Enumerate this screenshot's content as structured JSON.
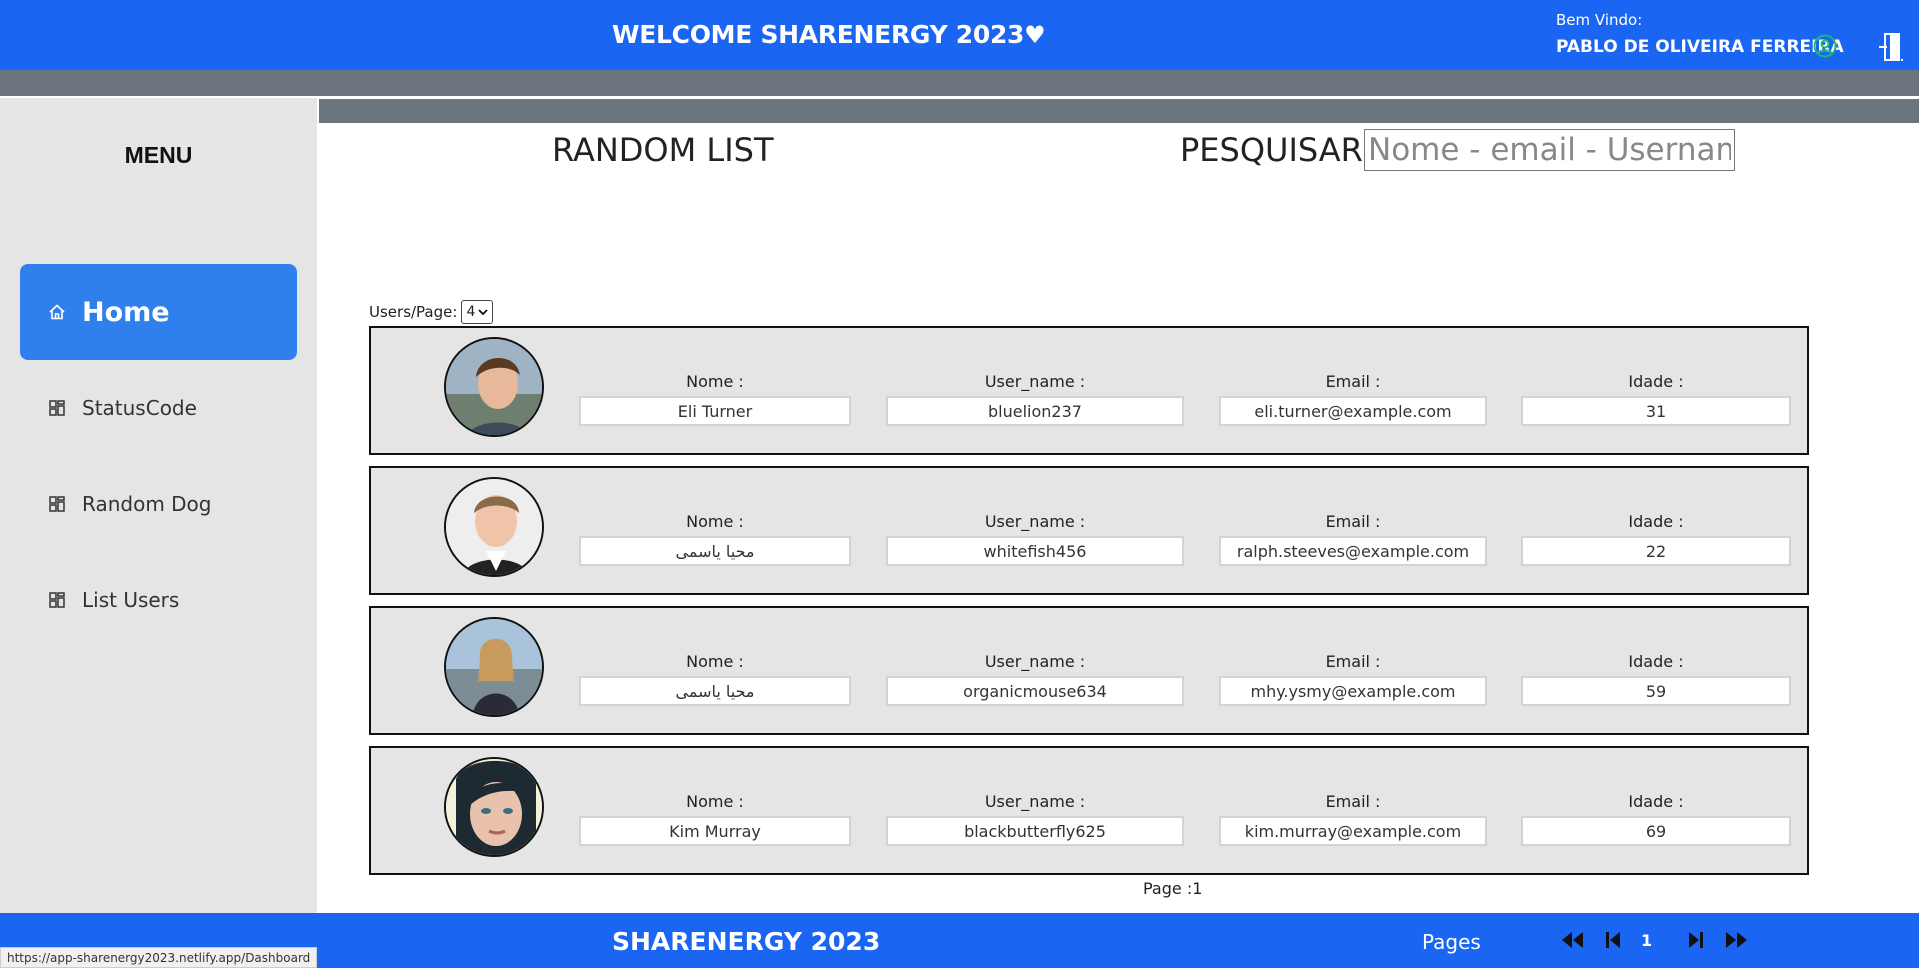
{
  "header": {
    "title": "WELCOME SHARENERGY 2023",
    "welcome_label": "Bem Vindo:",
    "user_name": "PABLO DE OLIVEIRA FERREIRA"
  },
  "sidebar": {
    "title": "MENU",
    "items": [
      {
        "label": "Home",
        "icon": "home-icon",
        "active": true
      },
      {
        "label": "StatusCode",
        "icon": "grid-icon",
        "active": false
      },
      {
        "label": "Random Dog",
        "icon": "grid-icon",
        "active": false
      },
      {
        "label": "List Users",
        "icon": "grid-icon",
        "active": false
      }
    ]
  },
  "main": {
    "heading": "RANDOM LIST",
    "search_label": "PESQUISAR :",
    "search_placeholder": "Nome - email - Username",
    "users_per_page_label": "Users/Page:",
    "users_per_page_value": "4",
    "page_indicator": "Page :1"
  },
  "field_labels": {
    "name": "Nome :",
    "username": "User_name :",
    "email": "Email :",
    "age": "Idade :"
  },
  "users": [
    {
      "name": "Eli Turner",
      "username": "bluelion237",
      "email": "eli.turner@example.com",
      "age": "31"
    },
    {
      "name": "محیا یاسمی",
      "username": "whitefish456",
      "email": "ralph.steeves@example.com",
      "age": "22"
    },
    {
      "name": "محیا یاسمی",
      "username": "organicmouse634",
      "email": "mhy.ysmy@example.com",
      "age": "59"
    },
    {
      "name": "Kim Murray",
      "username": "blackbutterfly625",
      "email": "kim.murray@example.com",
      "age": "69"
    }
  ],
  "footer": {
    "title": "SHARENERGY 2023",
    "pages_label": "Pages",
    "current_page": "1"
  },
  "status_url": "https://app-sharenergy2023.netlify.app/Dashboard",
  "colors": {
    "primary_blue": "#1a66f2",
    "active_nav": "#2f80ed",
    "grey_band": "#6c757d",
    "sidebar_bg": "#e5e5e5",
    "online_green": "#22b573"
  }
}
